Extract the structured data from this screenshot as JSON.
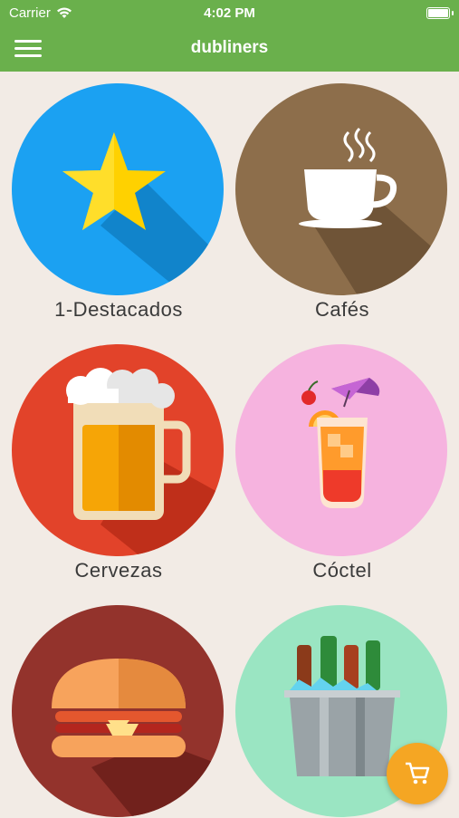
{
  "status_bar": {
    "carrier": "Carrier",
    "time": "4:02 PM"
  },
  "nav": {
    "title": "dubliners",
    "menu_icon": "hamburger-menu-icon"
  },
  "categories": [
    {
      "label": "1-Destacados",
      "icon": "star-icon",
      "color": "#1ba1f2"
    },
    {
      "label": "Cafés",
      "icon": "coffee-cup-icon",
      "color": "#8d6e4b"
    },
    {
      "label": "Cervezas",
      "icon": "beer-mug-icon",
      "color": "#e2432a"
    },
    {
      "label": "Cóctel",
      "icon": "cocktail-icon",
      "color": "#f6b3df"
    },
    {
      "label": "",
      "icon": "burger-icon",
      "color": "#93332c"
    },
    {
      "label": "",
      "icon": "ice-bucket-icon",
      "color": "#9ae5c2"
    }
  ],
  "cart": {
    "icon": "cart-icon",
    "color": "#f5a623"
  },
  "colors": {
    "header": "#6ab04c",
    "background": "#f2ebe5"
  }
}
